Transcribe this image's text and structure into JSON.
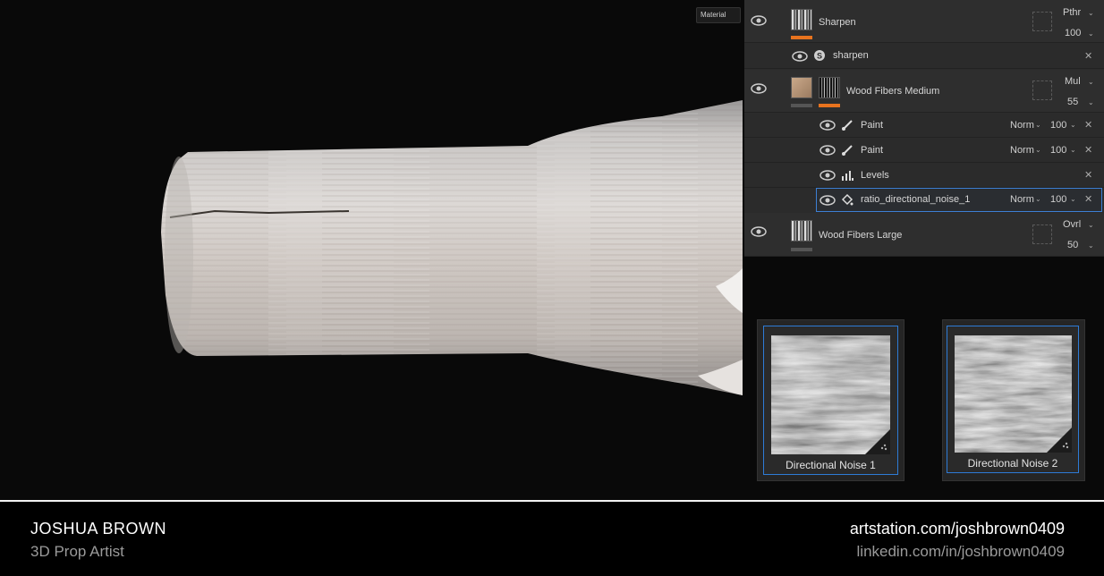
{
  "viewport": {
    "mode_label": "Material"
  },
  "layers": [
    {
      "type": "layer",
      "name": "Sharpen",
      "blend": "Pthr",
      "opacity": "100",
      "thumb": "fibers",
      "bar_color": "#e8731e",
      "selected": false
    },
    {
      "type": "effect",
      "name": "sharpen",
      "icon": "sharpen-icon",
      "selected": false
    },
    {
      "type": "layer",
      "name": "Wood Fibers Medium",
      "blend": "Mul",
      "opacity": "55",
      "thumb": "color",
      "bar_color": "#e8731e",
      "selected": false
    },
    {
      "type": "effect",
      "name": "Paint",
      "icon": "brush-icon",
      "blend": "Norm",
      "opacity": "100",
      "selected": false
    },
    {
      "type": "effect",
      "name": "Paint",
      "icon": "brush-icon",
      "blend": "Norm",
      "opacity": "100",
      "selected": false
    },
    {
      "type": "effect",
      "name": "Levels",
      "icon": "levels-icon",
      "selected": false
    },
    {
      "type": "effect",
      "name": "ratio_directional_noise_1",
      "icon": "fill-icon",
      "blend": "Norm",
      "opacity": "100",
      "selected": true
    },
    {
      "type": "layer",
      "name": "Wood Fibers Large",
      "blend": "Ovrl",
      "opacity": "50",
      "thumb": "fibers",
      "bar_color": "#555555",
      "selected": false
    }
  ],
  "cards": [
    {
      "label": "Directional Noise 1"
    },
    {
      "label": "Directional Noise 2"
    }
  ],
  "footer": {
    "name": "JOSHUA BROWN",
    "role": "3D Prop Artist",
    "artstation": "artstation.com/joshbrown0409",
    "linkedin": "linkedin.com/in/joshbrown0409"
  },
  "colors": {
    "accent": "#e8731e",
    "selection": "#3d7fd4",
    "panel": "#2b2b2b"
  }
}
